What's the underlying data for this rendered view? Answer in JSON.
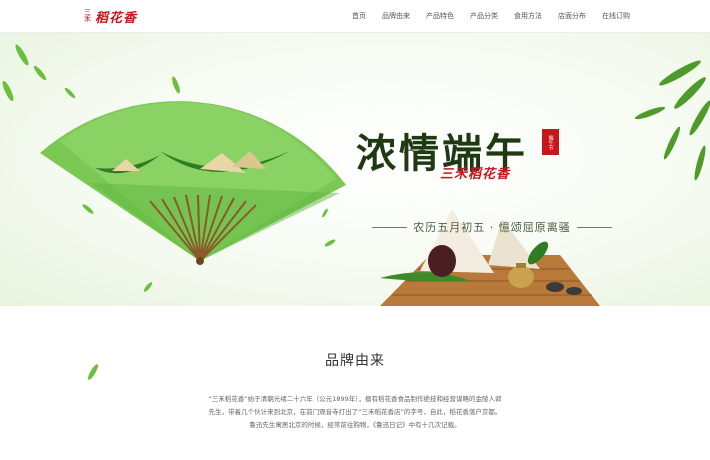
{
  "header": {
    "logo_small": "三禾",
    "logo_text": "稻花香",
    "nav": [
      "首页",
      "品牌由来",
      "产品特色",
      "产品分类",
      "食用方法",
      "店面分布",
      "在线订购"
    ]
  },
  "banner": {
    "headline": "浓情端午",
    "seal": "端午节",
    "brand": "三禾稻花香",
    "subtitle": "农历五月初五 · 憶颂屈原离骚"
  },
  "section": {
    "title": "品牌由来",
    "paragraphs": [
      "“三禾稻花香”始于清朝光绪二十六年（公元1899年），擅有稻花香食品制作绝技和经营谋略的金陵人郭",
      "先生，带着几个伙计来到北京，在前门观音寺打出了“三禾稻花香店”的字号，自此，稻花香落户京都。",
      "鲁迅先生寓居北京的时候，经常前往购物，《鲁迅日记》中有十几次记载。"
    ]
  },
  "colors": {
    "brand_red": "#c8161d",
    "fan_green": "#5fb53e",
    "dark_green": "#1f3a12"
  }
}
